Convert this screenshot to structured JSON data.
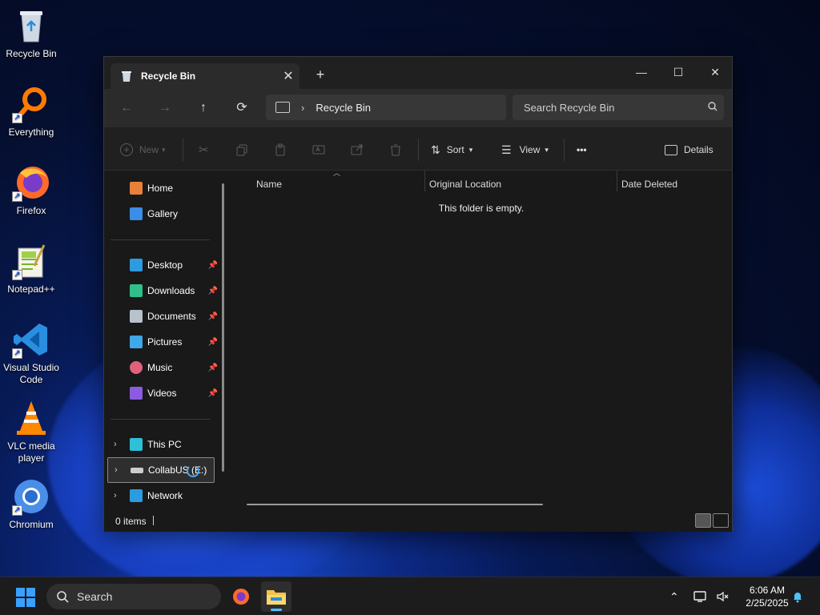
{
  "desktop": {
    "icons": [
      {
        "label": "Recycle Bin",
        "icon": "recycle-bin-icon"
      },
      {
        "label": "Everything",
        "icon": "everything-search-icon"
      },
      {
        "label": "Firefox",
        "icon": "firefox-icon"
      },
      {
        "label": "Notepad++",
        "icon": "notepad-plus-plus-icon"
      },
      {
        "label": "Visual Studio Code",
        "icon": "vscode-icon"
      },
      {
        "label": "VLC media player",
        "icon": "vlc-icon"
      },
      {
        "label": "Chromium",
        "icon": "chromium-icon"
      }
    ]
  },
  "window": {
    "tab_title": "Recycle Bin",
    "new_tab_label": "+",
    "controls": {
      "minimize": "—",
      "maximize": "☐",
      "close": "✕"
    }
  },
  "navbar": {
    "back": "←",
    "forward": "→",
    "up": "↑",
    "refresh": "⟳",
    "breadcrumb": "Recycle Bin",
    "search_placeholder": "Search Recycle Bin"
  },
  "toolbar": {
    "new_label": "New",
    "sort_label": "Sort",
    "view_label": "View",
    "more_label": "•••",
    "details_label": "Details"
  },
  "sidebar": {
    "quick": [
      {
        "label": "Home",
        "icon": "home-icon",
        "color": "#e8803a"
      },
      {
        "label": "Gallery",
        "icon": "gallery-icon",
        "color": "#3a8ee8"
      }
    ],
    "pinned": [
      {
        "label": "Desktop",
        "icon": "desktop-folder-icon",
        "color": "#2d9be0"
      },
      {
        "label": "Downloads",
        "icon": "downloads-icon",
        "color": "#2fbf8a"
      },
      {
        "label": "Documents",
        "icon": "documents-icon",
        "color": "#b8c2cc"
      },
      {
        "label": "Pictures",
        "icon": "pictures-icon",
        "color": "#3fa8e6"
      },
      {
        "label": "Music",
        "icon": "music-icon",
        "color": "#e0617a"
      },
      {
        "label": "Videos",
        "icon": "videos-icon",
        "color": "#8c5ce0"
      }
    ],
    "drives": [
      {
        "label": "This PC",
        "icon": "this-pc-icon",
        "color": "#2dc0d8"
      },
      {
        "label": "CollabUS (E:)",
        "icon": "drive-icon",
        "color": "#cccccc"
      },
      {
        "label": "Network",
        "icon": "network-icon",
        "color": "#2d9be0"
      }
    ]
  },
  "content": {
    "columns": [
      "Name",
      "Original Location",
      "Date Deleted"
    ],
    "empty_message": "This folder is empty."
  },
  "status": {
    "item_count": "0 items"
  },
  "taskbar": {
    "search_label": "Search",
    "time": "6:06 AM",
    "date": "2/25/2025",
    "accent": "#4cc2ff"
  }
}
